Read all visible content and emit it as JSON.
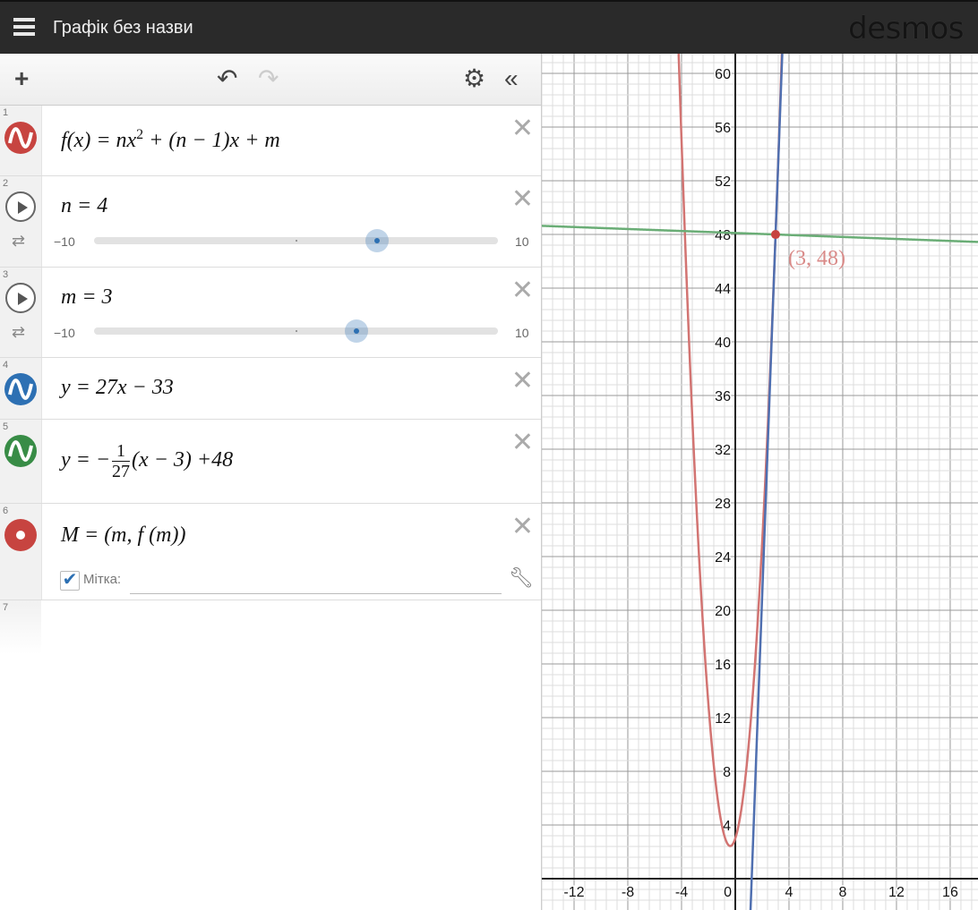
{
  "header": {
    "title": "Графік без назви",
    "logo": "desmos"
  },
  "toolbar": {
    "add": "+",
    "undo": "↶",
    "redo": "↷",
    "settings": "⚙",
    "collapse": "«"
  },
  "expressions": [
    {
      "num": "1",
      "color": "#c74440",
      "pre": "f",
      "p1": "(x)",
      "mid": " = nx",
      "sup": "2",
      "post": " + (n − 1)x + m"
    },
    {
      "num": "2",
      "text": "n = 4",
      "slider": {
        "min": "−10",
        "max": "10",
        "value": 4,
        "lo": -10,
        "hi": 10
      }
    },
    {
      "num": "3",
      "text": "m = 3",
      "slider": {
        "min": "−10",
        "max": "10",
        "value": 3,
        "lo": -10,
        "hi": 10
      }
    },
    {
      "num": "4",
      "color": "#2d70b3",
      "text": "y = 27x − 33"
    },
    {
      "num": "5",
      "color": "#388c46",
      "pre": "y = −",
      "frac_num": "1",
      "frac_den": "27",
      "post": "(x − 3) +48"
    },
    {
      "num": "6",
      "color": "#c74440",
      "text": "M = (m, f (m))",
      "label_text": "Мітка:",
      "label_value": ""
    },
    {
      "num": "7"
    }
  ],
  "graph": {
    "xlim": [
      -14.4,
      18.07
    ],
    "ylim": [
      -2.33,
      61.47
    ],
    "major_step": 4,
    "minor_div": 5,
    "x_ticks": [
      "-12",
      "-8",
      "-4",
      "0",
      "4",
      "8",
      "12",
      "16"
    ],
    "y_ticks": [
      "4",
      "8",
      "12",
      "16",
      "20",
      "24",
      "28",
      "32",
      "36",
      "40",
      "44",
      "48",
      "52",
      "56",
      "60"
    ],
    "params": {
      "n": 4,
      "m": 3
    },
    "curves": [
      {
        "name": "parabola",
        "color": "#d27472"
      },
      {
        "name": "tangent",
        "color": "#4f6fb0"
      },
      {
        "name": "normal",
        "color": "#6aad76"
      }
    ],
    "point": {
      "x": 3,
      "y": 48,
      "label": "(3, 48)",
      "color": "#c74440"
    }
  }
}
